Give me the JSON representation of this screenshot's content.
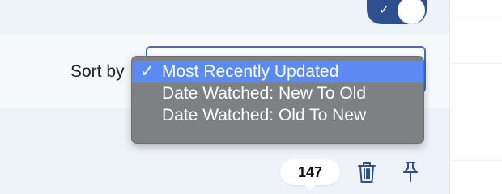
{
  "header": {
    "toggle": {
      "state": "on",
      "icon": "check-icon",
      "color": "#2f4f8f"
    }
  },
  "sort": {
    "label": "Sort by",
    "selected": "Most Recently Updated",
    "options": [
      {
        "label": "Most Recently Updated",
        "checked": true
      },
      {
        "label": "Date Watched: New To Old",
        "checked": false
      },
      {
        "label": "Date Watched: Old To New",
        "checked": false
      }
    ],
    "check_mark": "✓",
    "highlight_color": "#5b8bf2"
  },
  "footer": {
    "count": "147",
    "icons": [
      "trash-icon",
      "pin-icon"
    ]
  }
}
